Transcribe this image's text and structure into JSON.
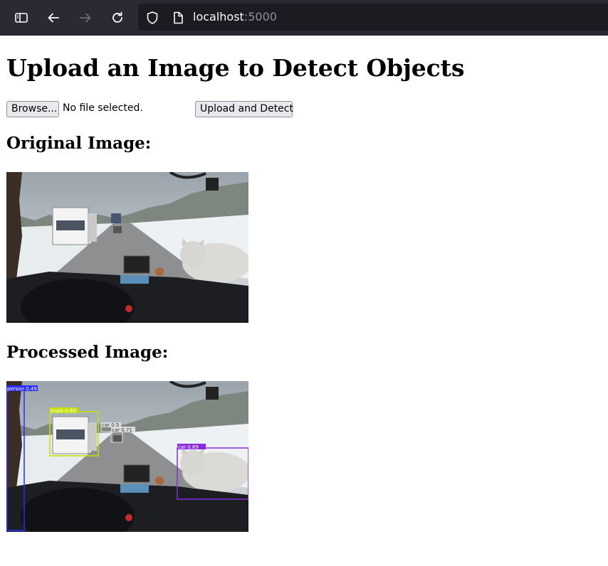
{
  "browser": {
    "url_host": "localhost",
    "url_port": ":5000",
    "icons": {
      "sidebar": "sidebar-icon",
      "back": "arrow-left-icon",
      "forward": "arrow-right-icon",
      "reload": "reload-icon",
      "shield": "shield-icon",
      "page": "page-icon"
    }
  },
  "page": {
    "title": "Upload an Image to Detect Objects",
    "browse_label": "Browse...",
    "file_status": "No file selected.",
    "submit_label": "Upload and Detect",
    "original_heading": "Original Image:",
    "processed_heading": "Processed Image:"
  },
  "detections": [
    {
      "label": "person 0.49",
      "color": "#2b2bff"
    },
    {
      "label": "truck 0.85",
      "color": "#c7e000"
    },
    {
      "label": "car 0.71",
      "color": "#dcdcdc"
    },
    {
      "label": "car 0.89",
      "color": "#8a2be2"
    },
    {
      "label": "car 0.5",
      "color": "#dcdcdc"
    }
  ]
}
